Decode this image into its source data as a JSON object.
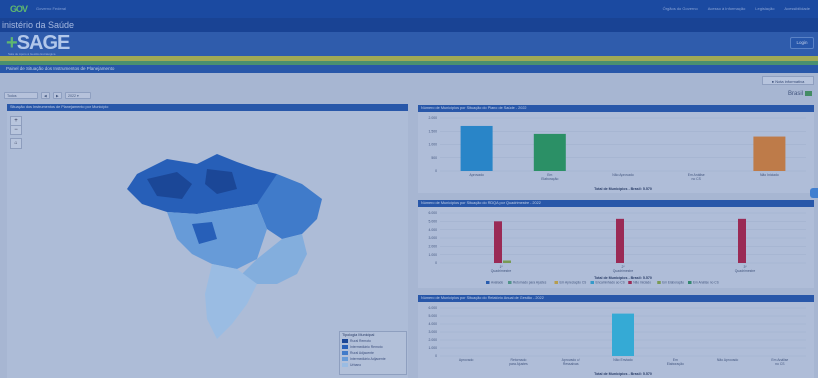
{
  "gov_bar": {
    "logo": "GOV",
    "subtitle": "Governo Federal",
    "links": [
      "Órgãos do Governo",
      "Acesso à Informação",
      "Legislação",
      "Acessibilidade"
    ]
  },
  "ministry": "inistério da Saúde",
  "header": {
    "logo": "SAGE",
    "logo_plus": "+",
    "tagline": "Sala de Apoio à Gestão Estratégica",
    "login_label": "Login"
  },
  "page_title": "Painel de Situação dos Instrumentos de Planejamento",
  "toolbar": {
    "nota_label": "Nota informativa",
    "brasil_label": "Brasil",
    "filters": [
      "Todos",
      "◀",
      "▶",
      "2022 ▾"
    ]
  },
  "map": {
    "title": "Situação dos Instrumentos de Planejamento por Município",
    "zoom_in": "+",
    "zoom_out": "−",
    "home": "⌂",
    "legend_title": "Tipologia Municipal",
    "legend": [
      {
        "label": "Rural Remoto",
        "color": "#1d4b9a"
      },
      {
        "label": "Intermediário Remoto",
        "color": "#2b68c2"
      },
      {
        "label": "Rural Adjacente",
        "color": "#4a8ad8"
      },
      {
        "label": "Intermediário Adjacente",
        "color": "#79b1ea"
      },
      {
        "label": "Urbano",
        "color": "#b7d9f7"
      }
    ]
  },
  "charts": [
    {
      "title": "Número de Municípios por Situação do Plano de Saúde - 2022",
      "type": "bar",
      "categories": [
        "Aprovado",
        "Em Elaboração",
        "Não Aprovado",
        "Em Análise no CS",
        "Não Iniciado"
      ],
      "values": [
        1700,
        1400,
        0,
        0,
        1300
      ],
      "colors": [
        "#2e96d6",
        "#30a45e",
        "#7aa",
        "#7aa",
        "#e38a3b"
      ],
      "ylim": [
        0,
        2000
      ],
      "yticks": [
        "2.000",
        "1.500",
        "1.000",
        "500",
        "0"
      ],
      "total_label": "Total de Municípios - Brasil: 5.570"
    },
    {
      "title": "Número de Municípios por Situação do RDQA por Quadrimestre - 2022",
      "type": "bar",
      "categories": [
        "1º Quadrimestre",
        "2º Quadrimestre",
        "3º Quadrimestre"
      ],
      "series": [
        {
          "name": "Avaliado",
          "color": "#2c64b8",
          "values": [
            0,
            0,
            0
          ]
        },
        {
          "name": "Retornado para Ajustes",
          "color": "#5ea88a",
          "values": [
            0,
            0,
            0
          ]
        },
        {
          "name": "Em Apreciação CS",
          "color": "#d8b444",
          "values": [
            0,
            0,
            0
          ]
        },
        {
          "name": "Encaminhado ao CS",
          "color": "#3cb0d8",
          "values": [
            0,
            0,
            0
          ]
        },
        {
          "name": "Não Iniciado",
          "color": "#b8284a",
          "values": [
            5000,
            5300,
            5300
          ]
        },
        {
          "name": "Em Elaboração",
          "color": "#8fb04a",
          "values": [
            300,
            0,
            0
          ]
        },
        {
          "name": "Em Análise no CS",
          "color": "#3a9a6a",
          "values": [
            0,
            0,
            0
          ]
        }
      ],
      "ylim": [
        0,
        6000
      ],
      "yticks": [
        "6.000",
        "5.000",
        "4.000",
        "3.000",
        "2.000",
        "1.000",
        "0"
      ],
      "total_label": "Total de Municípios - Brasil: 5.570"
    },
    {
      "title": "Número de Municípios por Situação do Relatório Anual de Gestão - 2022",
      "type": "bar",
      "categories": [
        "Aprovado",
        "Retornado para Ajustes",
        "Aprovado c/ Ressalvas",
        "Não Enviado",
        "Em Elaboração",
        "Não Aprovado",
        "Em Análise no CS"
      ],
      "values": [
        0,
        0,
        0,
        5300,
        0,
        0,
        0
      ],
      "colors": [
        "#2e96d6",
        "#2e96d6",
        "#2e96d6",
        "#3cc4e6",
        "#2e96d6",
        "#2e96d6",
        "#2e96d6"
      ],
      "ylim": [
        0,
        6000
      ],
      "yticks": [
        "6.000",
        "5.000",
        "4.000",
        "3.000",
        "2.000",
        "1.000",
        "0"
      ],
      "total_label": "Total de Municípios - Brasil: 5.570"
    }
  ],
  "chart_data": [
    {
      "type": "bar",
      "title": "Número de Municípios por Situação do Plano de Saúde - 2022",
      "categories": [
        "Aprovado",
        "Em Elaboração",
        "Não Aprovado",
        "Em Análise no CS",
        "Não Iniciado"
      ],
      "values": [
        1700,
        1400,
        0,
        0,
        1300
      ],
      "ylim": [
        0,
        2000
      ]
    },
    {
      "type": "bar",
      "title": "Número de Municípios por Situação do RDQA por Quadrimestre - 2022",
      "categories": [
        "1º Quadrimestre",
        "2º Quadrimestre",
        "3º Quadrimestre"
      ],
      "series": [
        {
          "name": "Não Iniciado",
          "values": [
            5000,
            5300,
            5300
          ]
        },
        {
          "name": "Em Elaboração",
          "values": [
            300,
            0,
            0
          ]
        }
      ],
      "ylim": [
        0,
        6000
      ]
    },
    {
      "type": "bar",
      "title": "Número de Municípios por Situação do Relatório Anual de Gestão - 2022",
      "categories": [
        "Aprovado",
        "Retornado para Ajustes",
        "Aprovado c/ Ressalvas",
        "Não Enviado",
        "Em Elaboração",
        "Não Aprovado",
        "Em Análise no CS"
      ],
      "values": [
        0,
        0,
        0,
        5300,
        0,
        0,
        0
      ],
      "ylim": [
        0,
        6000
      ]
    }
  ]
}
